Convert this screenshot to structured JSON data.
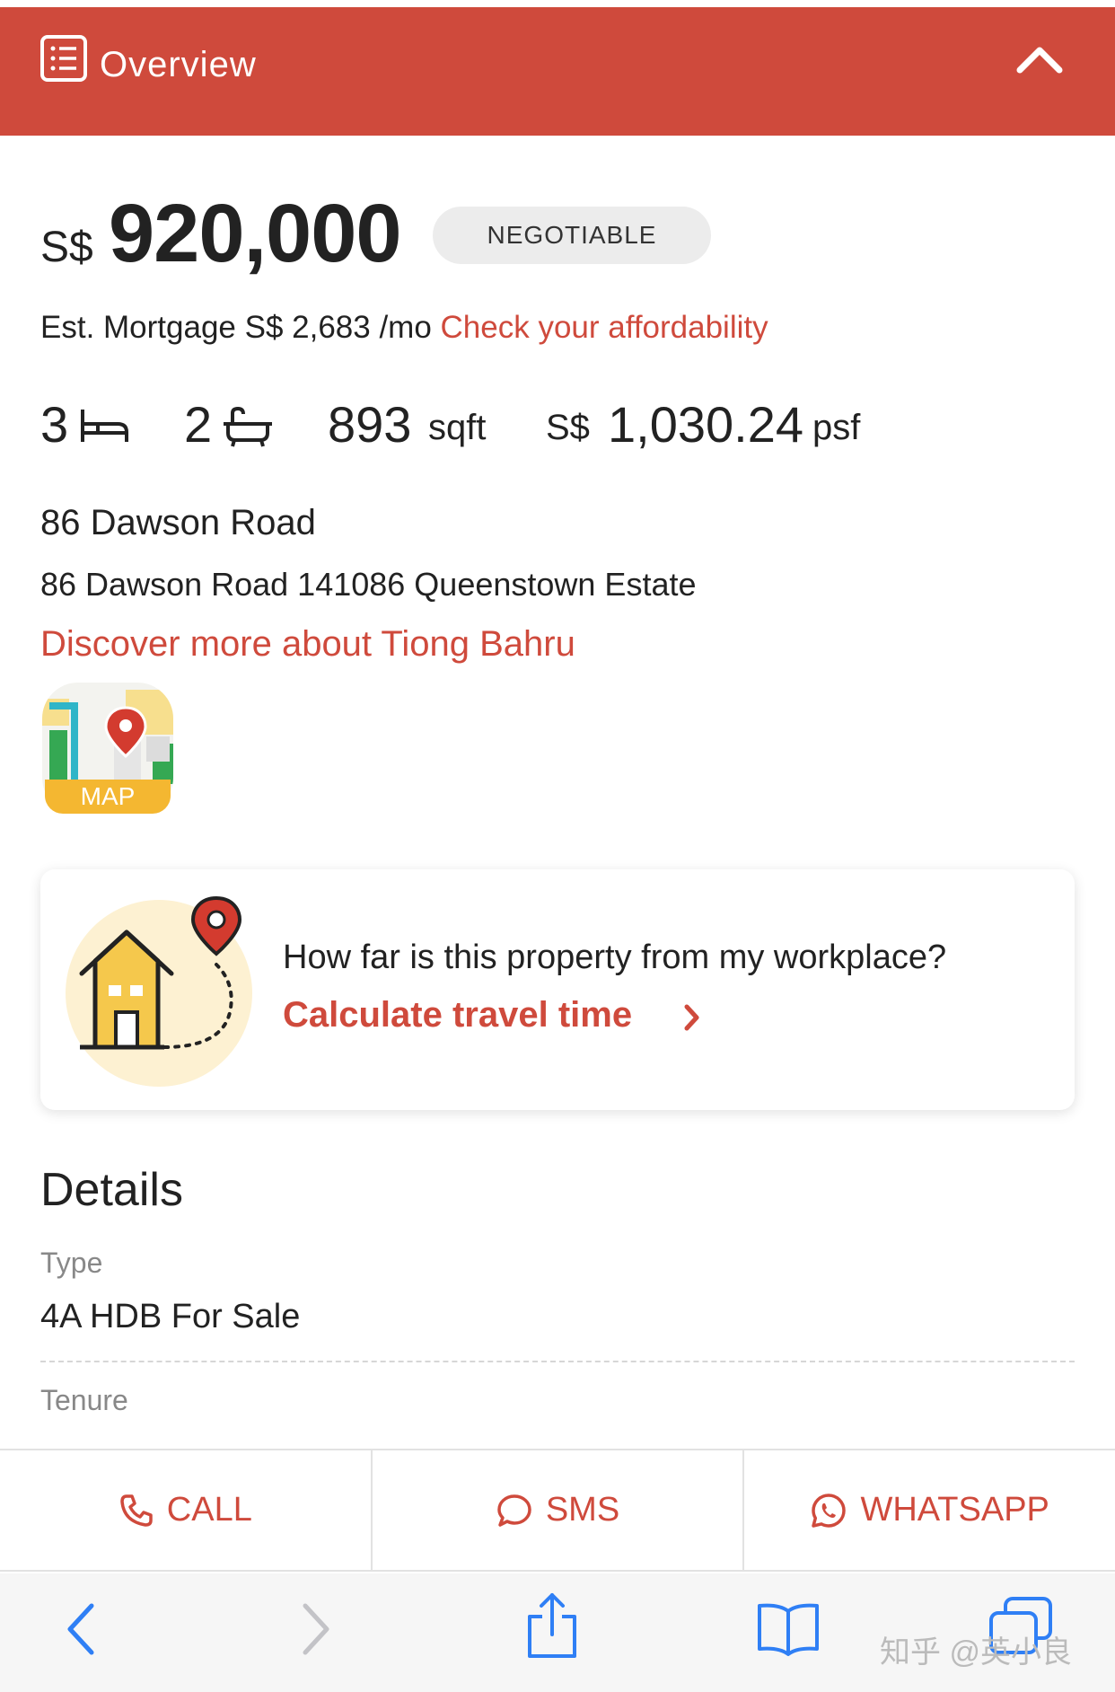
{
  "header": {
    "title": "Overview",
    "icon": "list-icon",
    "collapse_icon": "chevron-up-icon"
  },
  "listing": {
    "currency": "S$",
    "price": "920,000",
    "badge": "NEGOTIABLE",
    "mortgage_text": "Est. Mortgage S$ 2,683 /mo ",
    "mortgage_link": "Check your affordability",
    "bedrooms": "3",
    "bathrooms": "2",
    "area_value": "893",
    "area_unit": "sqft",
    "psf_currency": "S$",
    "psf_value": "1,030.24",
    "psf_unit": "psf"
  },
  "address": {
    "title": "86 Dawson Road",
    "full": "86 Dawson Road 141086 Queenstown Estate",
    "discover_link": "Discover more about Tiong Bahru"
  },
  "map_button": {
    "label": "MAP"
  },
  "travel_card": {
    "question": "How far is this property from my workplace?",
    "link": "Calculate travel time"
  },
  "details": {
    "title": "Details",
    "fields": [
      {
        "label": "Type",
        "value": "4A HDB For Sale"
      },
      {
        "label": "Tenure"
      }
    ]
  },
  "actions": [
    {
      "label": "CALL",
      "icon": "phone-icon"
    },
    {
      "label": "SMS",
      "icon": "chat-bubble-icon"
    },
    {
      "label": "WHATSAPP",
      "icon": "whatsapp-icon"
    }
  ],
  "browser_toolbar": {
    "icons": [
      "back-icon",
      "forward-icon",
      "share-icon",
      "bookmarks-icon",
      "tabs-icon"
    ]
  },
  "watermark": "知乎 @英小良",
  "colors": {
    "brand_red": "#cf4a3c",
    "map_yellow": "#f4b731",
    "ios_blue": "#2f7ff5"
  }
}
